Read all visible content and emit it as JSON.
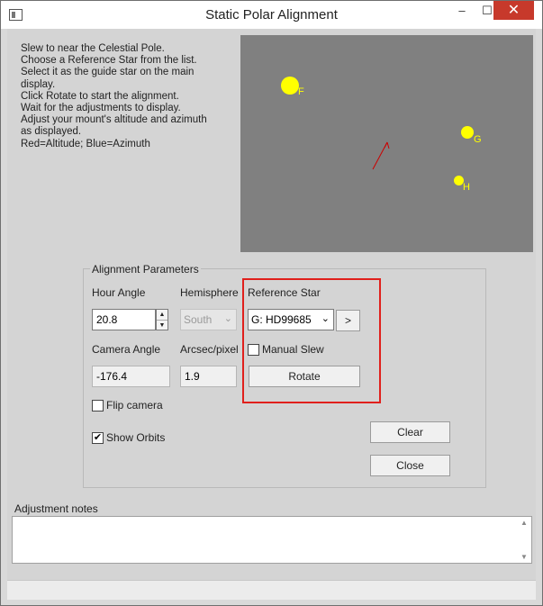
{
  "window": {
    "title": "Static Polar Alignment",
    "controls": {
      "minimize": "–",
      "maximize": "☐",
      "close": "✕"
    }
  },
  "instructions": [
    "Slew to near the Celestial Pole.",
    "Choose a Reference Star from the list.",
    "Select it as the guide star on the main",
    "display.",
    "Click Rotate to start the alignment.",
    "Wait for the adjustments to display.",
    "Adjust your mount's altitude and azimuth",
    "as displayed.",
    "Red=Altitude; Blue=Azimuth"
  ],
  "starfield": {
    "background": "#808080",
    "star_color": "#ffff00",
    "vector_color": "#cc0000",
    "stars": [
      {
        "label": "F"
      },
      {
        "label": "G"
      },
      {
        "label": "H"
      }
    ]
  },
  "params": {
    "group_title": "Alignment Parameters",
    "hour_angle": {
      "label": "Hour Angle",
      "value": "20.8"
    },
    "hemisphere": {
      "label": "Hemisphere",
      "value": "South"
    },
    "reference_star": {
      "label": "Reference Star",
      "value": "G: HD99685",
      "next_label": ">"
    },
    "camera_angle": {
      "label": "Camera Angle",
      "value": "-176.4"
    },
    "arcsec_pixel": {
      "label": "Arcsec/pixel",
      "value": "1.9"
    },
    "manual_slew": {
      "label": "Manual Slew",
      "checked": false
    },
    "rotate_label": "Rotate",
    "flip_camera": {
      "label": "Flip camera",
      "checked": false
    },
    "show_orbits": {
      "label": "Show Orbits",
      "checked": true,
      "mark": "✔"
    },
    "clear_label": "Clear",
    "close_label": "Close"
  },
  "notes": {
    "label": "Adjustment notes",
    "value": ""
  }
}
